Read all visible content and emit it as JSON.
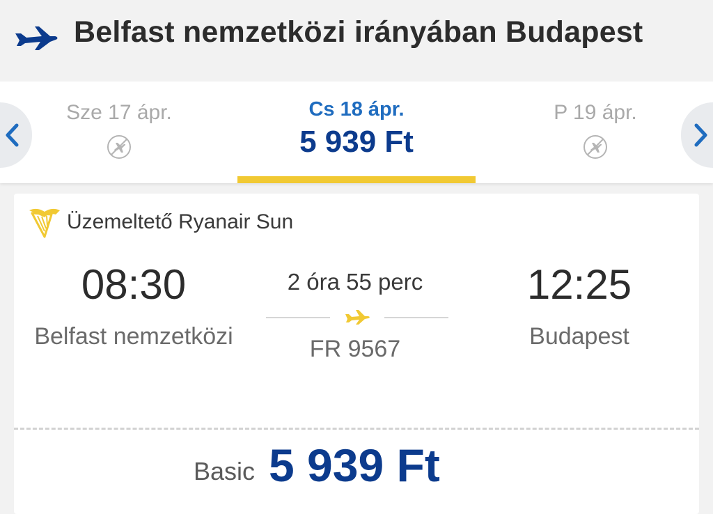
{
  "header": {
    "title": "Belfast nemzetközi irányában Budapest",
    "icon": "plane-icon",
    "accent_color": "#0c3b8d"
  },
  "dates": [
    {
      "label": "Sze 17 ápr.",
      "price": null,
      "status": "no-flights",
      "icon": "no-flight-icon"
    },
    {
      "label": "Cs 18 ápr.",
      "price": "5 939 Ft",
      "status": "selected"
    },
    {
      "label": "P 19 ápr.",
      "price": null,
      "status": "no-flights",
      "icon": "no-flight-icon"
    }
  ],
  "nav": {
    "prev_icon": "chevron-left-icon",
    "next_icon": "chevron-right-icon"
  },
  "flight": {
    "operator": "Üzemeltető Ryanair Sun",
    "departure_time": "08:30",
    "departure_city": "Belfast nemzetközi",
    "duration": "2 óra 55 perc",
    "flight_number": "FR 9567",
    "arrival_time": "12:25",
    "arrival_city": "Budapest"
  },
  "fare": {
    "label": "Basic",
    "price": "5 939 Ft"
  },
  "colors": {
    "brand_blue": "#0c3b8d",
    "selected_blue": "#1f6cbf",
    "highlight_yellow": "#f1c933"
  }
}
